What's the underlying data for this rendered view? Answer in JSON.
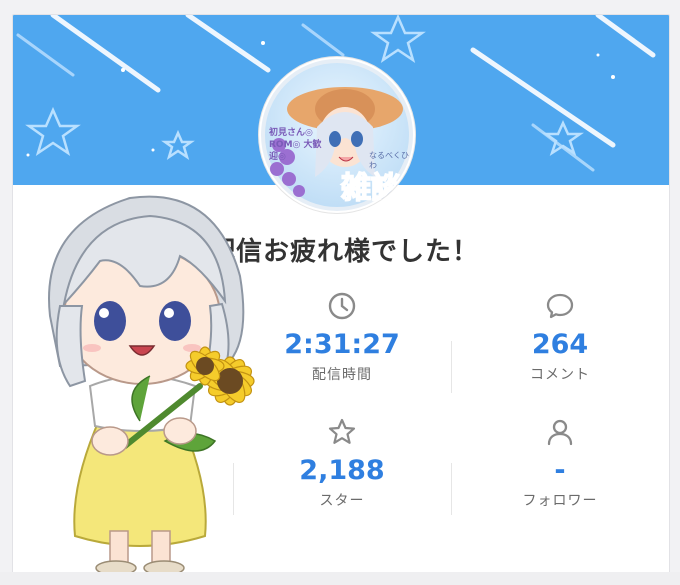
{
  "summary": {
    "title": "配信お疲れ様でした！"
  },
  "stats": [
    {
      "icon": "clock-icon",
      "value": "2:31:27",
      "label": "配信時間"
    },
    {
      "icon": "comment-bubble-icon",
      "value": "264",
      "label": "コメント"
    },
    {
      "icon": "star-icon",
      "value": "2,188",
      "label": "スター"
    },
    {
      "icon": "person-icon",
      "value": "-",
      "label": "フォロワー"
    }
  ],
  "avatar": {
    "caption_top": "初見さん◎ ROM◎ 大歓迎◎",
    "caption_side": "なるべくひ わ",
    "caption_main": "雑談"
  },
  "colors": {
    "banner": "#4fa7ef",
    "value_text": "#2f7fe0",
    "title_text": "#333333"
  }
}
